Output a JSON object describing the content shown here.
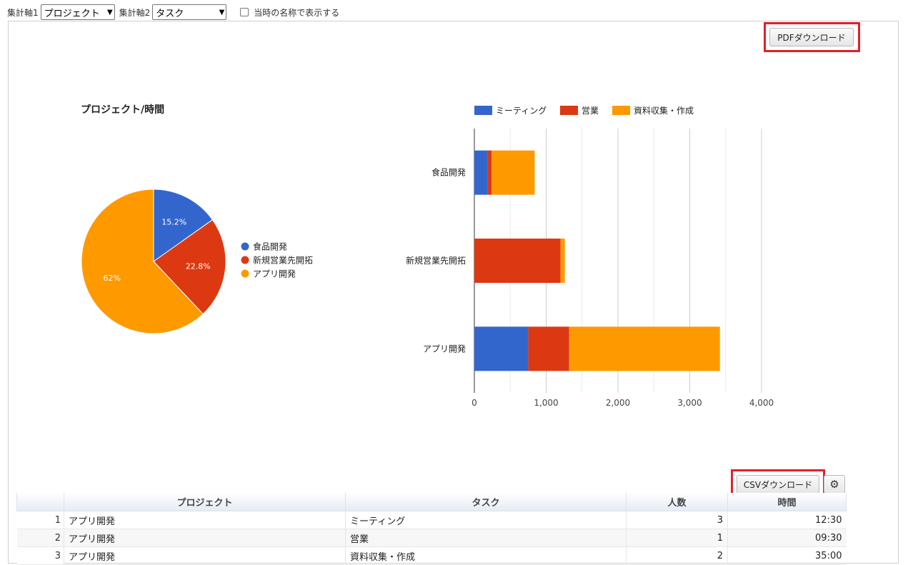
{
  "toolbar": {
    "axis1_label": "集計軸1",
    "axis1_value": "プロジェクト",
    "axis2_label": "集計軸2",
    "axis2_value": "タスク",
    "checkbox_label": "当時の名称で表示する",
    "checkbox_checked": false
  },
  "buttons": {
    "pdf_download": "PDFダウンロード",
    "csv_download": "CSVダウンロード"
  },
  "colors": {
    "blue": "#3366cc",
    "red": "#dc3912",
    "orange": "#ff9900",
    "highlight": "#e0202a"
  },
  "chart_data": [
    {
      "type": "pie",
      "title": "プロジェクト/時間",
      "legend_position": "right",
      "categories": [
        "食品開発",
        "新規営業先開拓",
        "アプリ開発"
      ],
      "values": [
        15.2,
        22.8,
        62
      ],
      "data_labels": [
        "15.2%",
        "22.8%",
        "62%"
      ],
      "colors": [
        "#3366cc",
        "#dc3912",
        "#ff9900"
      ]
    },
    {
      "type": "bar",
      "orientation": "horizontal",
      "stacked": true,
      "legend_position": "top",
      "categories": [
        "食品開発",
        "新規営業先開拓",
        "アプリ開発"
      ],
      "series": [
        {
          "name": "ミーティング",
          "color": "#3366cc",
          "values": [
            180,
            0,
            750
          ]
        },
        {
          "name": "営業",
          "color": "#dc3912",
          "values": [
            60,
            1200,
            570
          ]
        },
        {
          "name": "資料収集・作成",
          "color": "#ff9900",
          "values": [
            600,
            60,
            2100
          ]
        }
      ],
      "xlim": [
        0,
        4000
      ],
      "x_ticks": [
        "0",
        "1,000",
        "2,000",
        "3,000",
        "4,000"
      ],
      "grid": true
    }
  ],
  "table": {
    "columns": [
      "",
      "プロジェクト",
      "タスク",
      "人数",
      "時間"
    ],
    "rows": [
      {
        "index": "1",
        "project": "アプリ開発",
        "task": "ミーティング",
        "people": "3",
        "time": "12:30"
      },
      {
        "index": "2",
        "project": "アプリ開発",
        "task": "営業",
        "people": "1",
        "time": "09:30"
      },
      {
        "index": "3",
        "project": "アプリ開発",
        "task": "資料収集・作成",
        "people": "2",
        "time": "35:00"
      }
    ]
  }
}
